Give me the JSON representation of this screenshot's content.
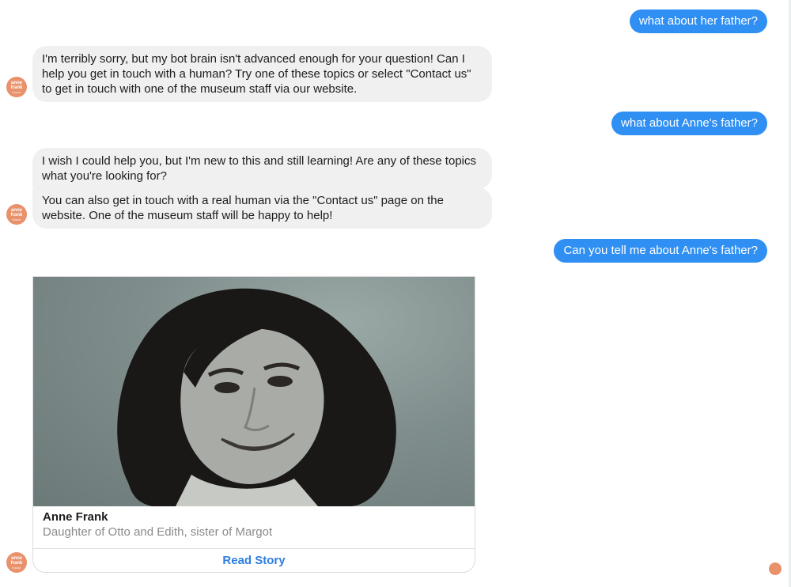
{
  "conversation": {
    "messages": [
      {
        "from": "user",
        "text": "what about her father?"
      },
      {
        "from": "bot",
        "text": "I'm terribly sorry, but my bot brain isn't advanced enough for your question! Can I help you get in touch with a human? Try one of these topics or select \"Contact us\" to get in touch with one of the museum staff via our website."
      },
      {
        "from": "user",
        "text": "what about Anne's father?"
      },
      {
        "from": "bot",
        "text": "I wish I could help you, but I'm new to this and still learning! Are any of these topics what you're looking for?"
      },
      {
        "from": "bot",
        "text": "You can also get in touch with a real human via the \"Contact us\" page on the website. One of the museum staff will be happy to help!"
      },
      {
        "from": "user",
        "text": "Can you tell me about Anne's father?"
      }
    ]
  },
  "bot_avatar": {
    "line1": "anne",
    "line2": "frank",
    "line3": "house",
    "color": "#e8916a"
  },
  "card": {
    "title": "Anne Frank",
    "subtitle": "Daughter of Otto and Edith, sister of Margot",
    "button_label": "Read Story"
  },
  "colors": {
    "user_bubble": "#2f8ff3",
    "bot_bubble": "#f1f0f0",
    "link": "#2e7ee0"
  }
}
